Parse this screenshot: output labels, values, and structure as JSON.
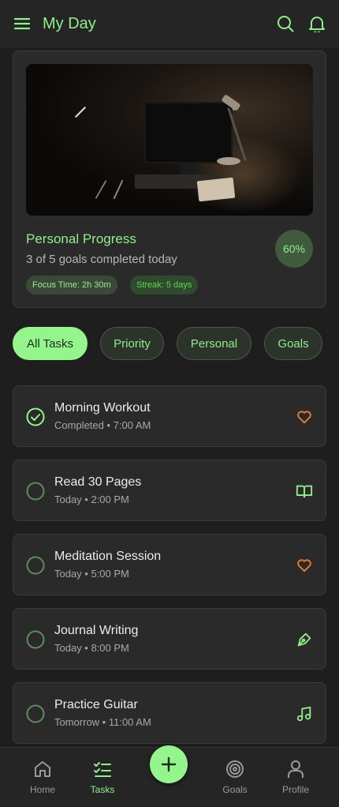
{
  "header": {
    "title": "My Day",
    "icons": [
      "menu-icon",
      "search-icon",
      "bell-icon"
    ]
  },
  "progress": {
    "title": "Personal Progress",
    "subtitle": "3 of 5 goals completed today",
    "percent": "60%",
    "focus_chip": "Focus Time: 2h 30m",
    "streak_chip": "Streak: 5 days"
  },
  "filters": [
    {
      "label": "All Tasks",
      "active": true
    },
    {
      "label": "Priority",
      "active": false
    },
    {
      "label": "Personal",
      "active": false
    },
    {
      "label": "Goals",
      "active": false
    }
  ],
  "tasks": [
    {
      "name": "Morning Workout",
      "meta": "Completed • 7:00 AM",
      "done": true,
      "icon": "heart-icon"
    },
    {
      "name": "Read 30 Pages",
      "meta": "Today • 2:00 PM",
      "done": false,
      "icon": "book-icon"
    },
    {
      "name": "Meditation Session",
      "meta": "Today • 5:00 PM",
      "done": false,
      "icon": "heart-icon"
    },
    {
      "name": "Journal Writing",
      "meta": "Today • 8:00 PM",
      "done": false,
      "icon": "pen-icon"
    },
    {
      "name": "Practice Guitar",
      "meta": "Tomorrow • 11:00 AM",
      "done": false,
      "icon": "music-icon"
    }
  ],
  "nav": {
    "home": "Home",
    "tasks": "Tasks",
    "goals": "Goals",
    "profile": "Profile",
    "active": "Tasks"
  },
  "colors": {
    "accent": "#93f58c",
    "accent_text": "#8ff08a",
    "heart": "#f27c2a",
    "background": "#1e1e1e",
    "card": "#2a2a2a"
  }
}
